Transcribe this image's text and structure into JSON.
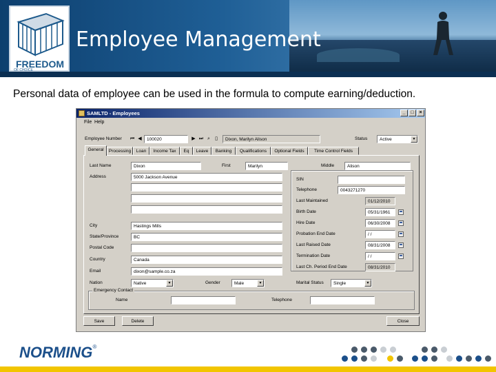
{
  "slide": {
    "title": "Employee Management",
    "caption": "Personal data of employee can be used in the formula to compute earning/deduction.",
    "logo_text": "FREEDOM",
    "logo_subtext": "OF CHOICE",
    "footer_logo": "NORMING",
    "footer_logo_mark": "®"
  },
  "window": {
    "title": "SAMLTD - Employees",
    "menu": [
      "File",
      "Help"
    ],
    "employee_number_label": "Employee Number",
    "employee_number": "100020",
    "employee_name": "Dixon, Marilyn Alison",
    "status_label": "Status",
    "status_value": "Active",
    "tabs": [
      "General",
      "Processing",
      "Loan",
      "Income Tax",
      "Eq",
      "Leave",
      "Banking",
      "Qualifications",
      "Optional Fields",
      "Time Control Fields"
    ],
    "general": {
      "last_name_label": "Last Name",
      "last_name": "Dixon",
      "first_label": "First",
      "first": "Marilyn",
      "middle_label": "Middle",
      "middle": "Alison",
      "address_label": "Address",
      "address": [
        "5000 Jackson Avenue",
        "",
        "",
        ""
      ],
      "city_label": "City",
      "city": "Hastings Mills",
      "state_label": "State/Province",
      "state": "BC",
      "postal_label": "Postal Code",
      "postal": "",
      "country_label": "Country",
      "country": "Canada",
      "email_label": "Email",
      "email": "dixon@sample.co.za",
      "nation_label": "Nation",
      "nation": "Native",
      "gender_label": "Gender",
      "gender": "Male",
      "marital_label": "Marital Status",
      "marital": "Single",
      "sin_label": "SIN",
      "sin": "",
      "telephone_label": "Telephone",
      "telephone": "0043271270",
      "last_maintained_label": "Last Maintained",
      "last_maintained": "01/12/2010",
      "birth_date_label": "Birth Date",
      "birth_date": "05/31/1961",
      "hire_date_label": "Hire Date",
      "hire_date": "06/30/2008",
      "probation_label": "Probation End Date",
      "probation": "/ /",
      "last_raise_label": "Last Raised Date",
      "last_raise": "08/31/2008",
      "termination_label": "Termination Date",
      "termination": "/ /",
      "last_pay_label": "Last Ch. Period End Date",
      "last_pay": "08/31/2010",
      "emergency_title": "Emergency Contact",
      "em_name_label": "Name",
      "em_name": "",
      "em_phone_label": "Telephone",
      "em_phone": ""
    },
    "buttons": {
      "save": "Save",
      "delete": "Delete",
      "close": "Close"
    }
  },
  "colors": {
    "header_blue": "#1f5f96",
    "footer_yellow": "#f2c500",
    "norming_blue": "#1b4f8a",
    "dot_gray": "#4a5a6a"
  }
}
